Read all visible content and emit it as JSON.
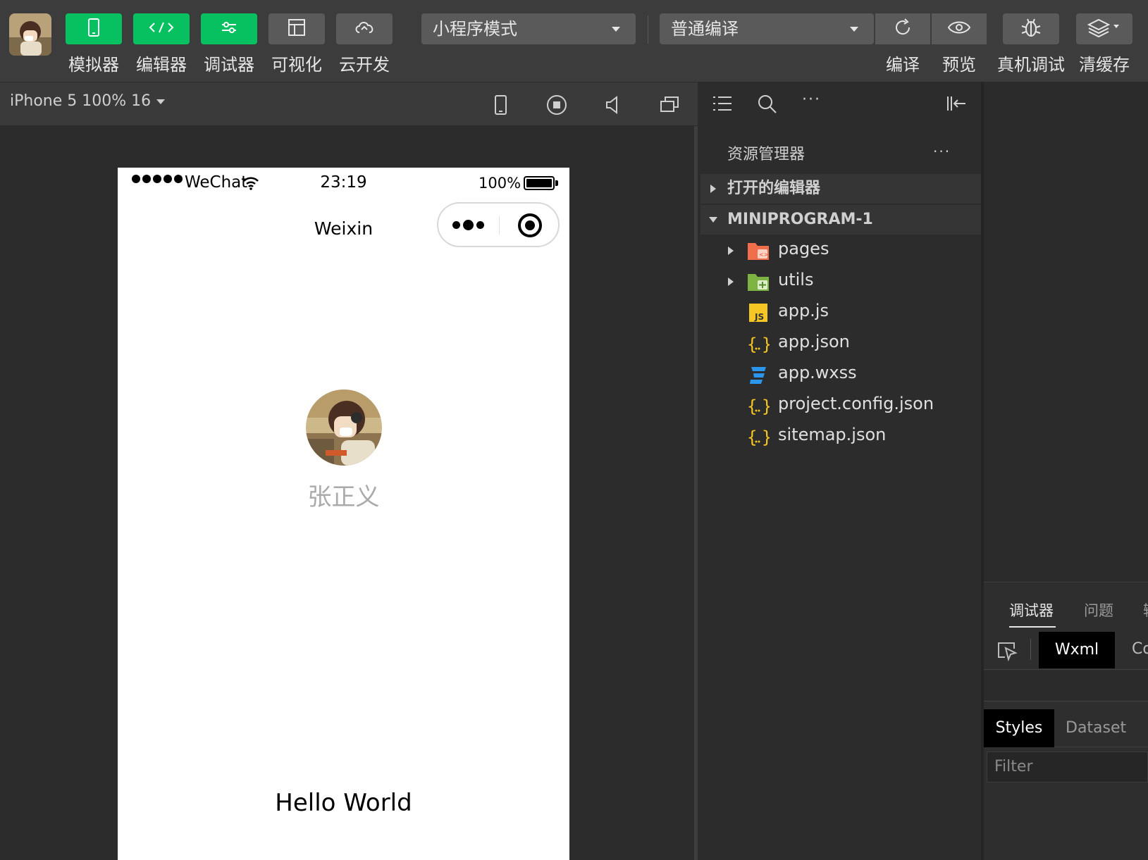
{
  "toolbar": {
    "mode_buttons": [
      {
        "label": "模拟器",
        "icon": "phone-icon"
      },
      {
        "label": "编辑器",
        "icon": "code-icon"
      },
      {
        "label": "调试器",
        "icon": "sliders-icon"
      },
      {
        "label": "可视化",
        "icon": "layout-icon"
      },
      {
        "label": "云开发",
        "icon": "cloud-icon"
      }
    ],
    "mode_select": "小程序模式",
    "compile_select": "普通编译",
    "actions": [
      {
        "label": "编译",
        "icon": "refresh-icon"
      },
      {
        "label": "预览",
        "icon": "eye-icon"
      },
      {
        "label": "真机调试",
        "icon": "bug-icon"
      },
      {
        "label": "清缓存",
        "icon": "layers-icon"
      }
    ],
    "colors": {
      "active": "#07c160",
      "inactive": "#5a5a5a"
    }
  },
  "simulator": {
    "device": "iPhone 5 100% 16",
    "status": {
      "carrier": "WeChat",
      "time": "23:19",
      "battery": "100%"
    },
    "nav_title": "Weixin",
    "user_name": "张正义",
    "hello": "Hello World"
  },
  "explorer": {
    "title": "资源管理器",
    "more": "···",
    "open_editors": "打开的编辑器",
    "project": "MINIPROGRAM-1",
    "files": [
      {
        "name": "pages",
        "icon": "folder-pages-icon"
      },
      {
        "name": "utils",
        "icon": "folder-utils-icon"
      },
      {
        "name": "app.js",
        "icon": "js-file-icon"
      },
      {
        "name": "app.json",
        "icon": "json-file-icon"
      },
      {
        "name": "app.wxss",
        "icon": "css-file-icon"
      },
      {
        "name": "project.config.json",
        "icon": "json-file-icon"
      },
      {
        "name": "sitemap.json",
        "icon": "json-file-icon"
      }
    ]
  },
  "debugger": {
    "tabs": [
      "调试器",
      "问题",
      "输"
    ],
    "wxml_tab": "Wxml",
    "co_tab": "Co",
    "styles_tab": "Styles",
    "dataset_tab": "Dataset",
    "filter_placeholder": "Filter"
  }
}
